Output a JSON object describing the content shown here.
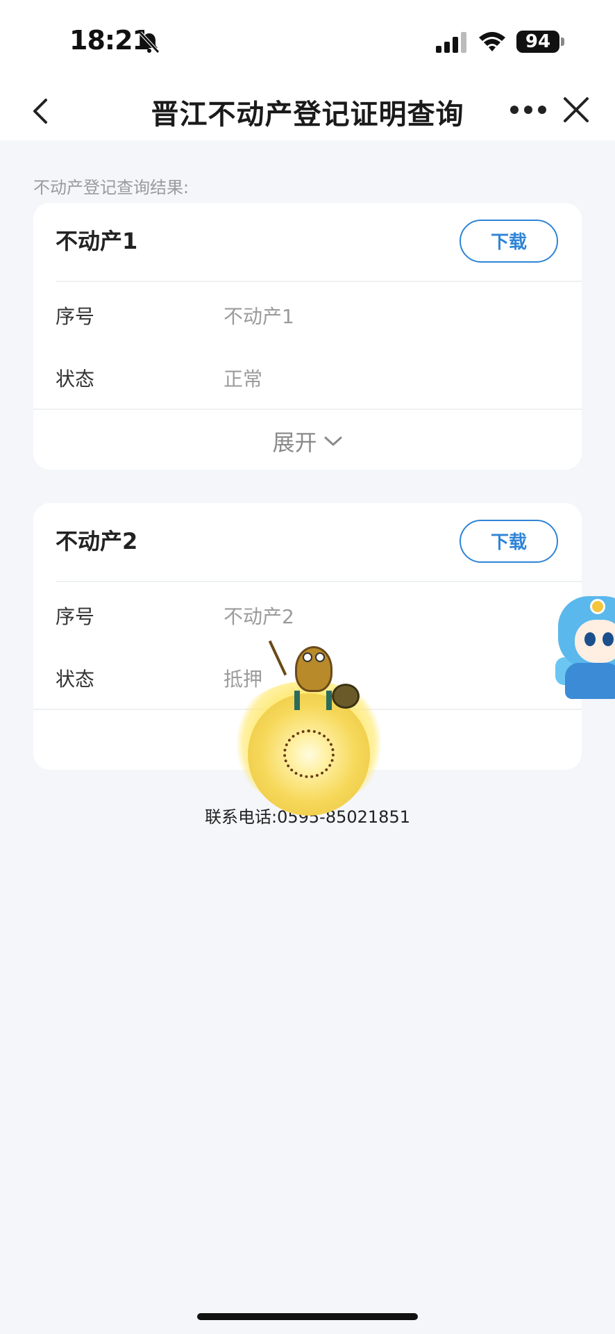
{
  "status_bar": {
    "time": "18:21",
    "battery": "94",
    "icons": [
      "bell-slash-icon",
      "cellular-signal-icon",
      "wifi-icon",
      "battery-icon"
    ]
  },
  "nav": {
    "title": "晋江不动产登记证明查询",
    "icons": [
      "chevron-left-icon",
      "more-dots-icon",
      "close-icon"
    ]
  },
  "results": {
    "section_label": "不动产登记查询结果:",
    "download_label": "下载",
    "expand_label": "展开",
    "properties": [
      {
        "title": "不动产1",
        "rows": [
          {
            "label": "序号",
            "value": "不动产1"
          },
          {
            "label": "状态",
            "value": "正常"
          }
        ]
      },
      {
        "title": "不动产2",
        "rows": [
          {
            "label": "序号",
            "value": "不动产2"
          },
          {
            "label": "状态",
            "value": "抵押"
          }
        ]
      }
    ]
  },
  "footer": {
    "contact": "联系电话:0595-85021851"
  },
  "colors": {
    "accent": "#2f84d6",
    "background": "#f4f6fa",
    "card": "#ffffff"
  }
}
